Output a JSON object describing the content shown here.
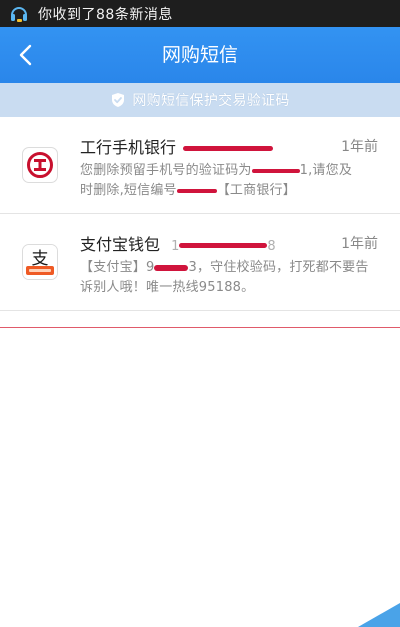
{
  "status_bar": {
    "notification_text": "你收到了88条新消息"
  },
  "header": {
    "title": "网购短信"
  },
  "banner": {
    "text": "网购短信保护交易验证码"
  },
  "messages": [
    {
      "sender": "工行手机银行",
      "time": "1年前",
      "preview_line1": "您删除预留手机号的验证码为",
      "preview_line1_tail": "1,请您及",
      "preview_line2": "时删除,短信编号",
      "preview_line2_tail": "【工商银行】"
    },
    {
      "sender": "支付宝钱包",
      "sender_suffix": "1",
      "sender_tail": "8",
      "time": "1年前",
      "preview_line1": "【支付宝】9",
      "preview_line1_tail": "3，守住校验码，打死都不要告",
      "preview_line2": "诉别人哦！唯一热线95188。"
    }
  ],
  "colors": {
    "header_blue": "#2d8cf0",
    "banner_blue": "#c9dcf1",
    "redaction_red": "#d0143c"
  }
}
